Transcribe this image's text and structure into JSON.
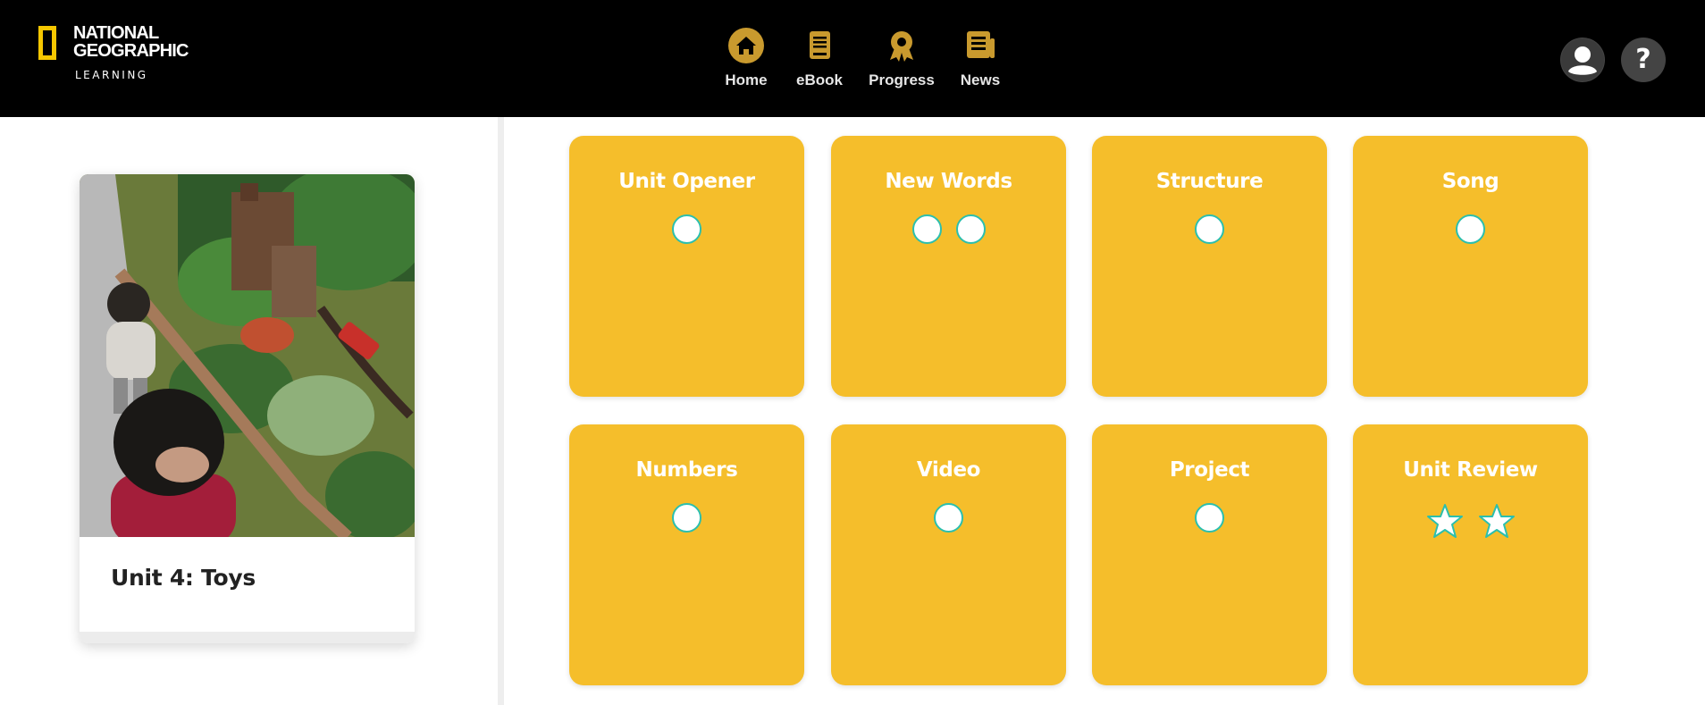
{
  "header": {
    "logo": {
      "line1": "NATIONAL",
      "line2": "GEOGRAPHIC",
      "line3": "LEARNING"
    },
    "nav": [
      {
        "label": "Home",
        "icon": "home-icon"
      },
      {
        "label": "eBook",
        "icon": "ebook-icon"
      },
      {
        "label": "Progress",
        "icon": "award-icon"
      },
      {
        "label": "News",
        "icon": "newspaper-icon"
      }
    ],
    "user_icon": "user-avatar-icon",
    "help_label": "?"
  },
  "unit": {
    "title": "Unit 4: Toys"
  },
  "tiles": [
    {
      "title": "Unit Opener",
      "circles": 1
    },
    {
      "title": "New Words",
      "circles": 2
    },
    {
      "title": "Structure",
      "circles": 1
    },
    {
      "title": "Song",
      "circles": 1
    },
    {
      "title": "Numbers",
      "circles": 1
    },
    {
      "title": "Video",
      "circles": 1
    },
    {
      "title": "Project",
      "circles": 1
    },
    {
      "title": "Unit Review",
      "stars": 2
    }
  ],
  "colors": {
    "header_bg": "#000000",
    "accent_gold": "#c99a2e",
    "tile_bg": "#f5be2b",
    "circle_border": "#2bbfae"
  }
}
